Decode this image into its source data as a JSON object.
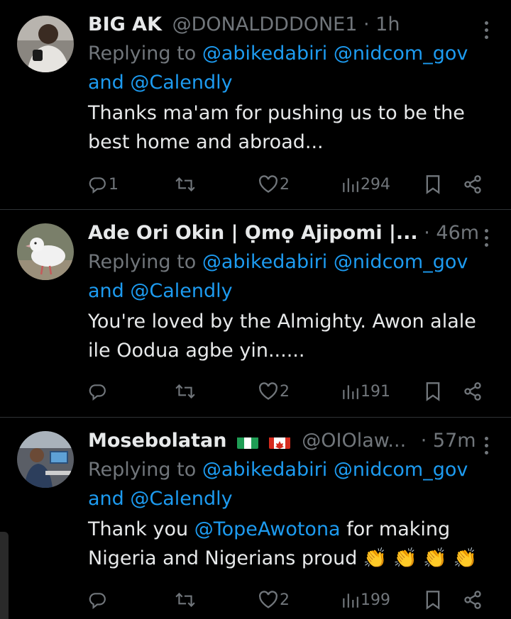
{
  "tweets": [
    {
      "name": "BIG AK",
      "handle": "@DONALDDDONE1",
      "time": "1h",
      "replying_prefix": "Replying to",
      "replying_to": [
        "@abikedabiri",
        "@nidcom_gov"
      ],
      "replying_and": "and",
      "replying_last": "@Calendly",
      "text_lines": [
        "Thanks ma'am for pushing us to be the",
        "best home and abroad..."
      ],
      "replies": "1",
      "retweets": "",
      "likes": "2",
      "views": "294"
    },
    {
      "name": "Ade Ori Okin | Ọmọ Ajipomi |...",
      "handle": "",
      "time": "46m",
      "replying_prefix": "Replying to",
      "replying_to": [
        "@abikedabiri",
        "@nidcom_gov"
      ],
      "replying_and": "and",
      "replying_last": "@Calendly",
      "text_lines": [
        "You're loved by the Almighty. Awon alale",
        "ile Oodua agbe yin......"
      ],
      "replies": "",
      "retweets": "",
      "likes": "2",
      "views": "191"
    },
    {
      "name": "Mosebolatan",
      "handle": "@OIOlaw...",
      "time": "57m",
      "replying_prefix": "Replying to",
      "replying_to": [
        "@abikedabiri",
        "@nidcom_gov"
      ],
      "replying_and": "and",
      "replying_last": "@Calendly",
      "text_prefix": "Thank you ",
      "text_mention": "@TopeAwotona",
      "text_suffix": " for making",
      "text_line2": "Nigeria and Nigerians proud ",
      "emoji": "👏 👏 👏 👏",
      "replies": "",
      "retweets": "",
      "likes": "2",
      "views": "199"
    }
  ],
  "colors": {
    "background": "#000000",
    "text": "#e7e9ea",
    "muted": "#71767b",
    "link": "#1d9bf0",
    "divider": "#2f3336"
  },
  "icons": [
    "reply-icon",
    "retweet-icon",
    "like-icon",
    "views-icon",
    "bookmark-icon",
    "share-icon",
    "more-icon"
  ]
}
